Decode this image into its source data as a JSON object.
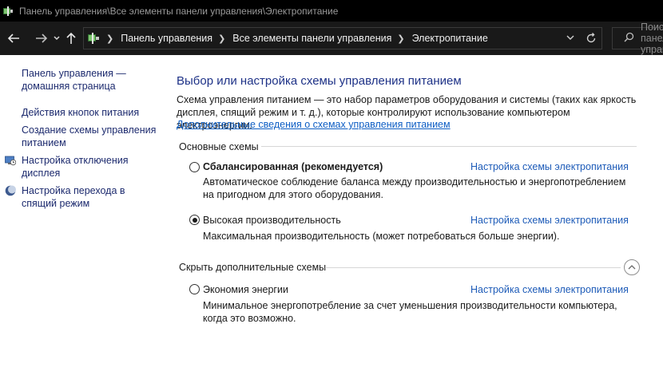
{
  "window": {
    "title": "Панель управления\\Все элементы панели управления\\Электропитание"
  },
  "nav": {
    "back_icon": "arrow-left-icon",
    "forward_icon": "arrow-right-icon",
    "up_icon": "arrow-up-icon",
    "breadcrumbs": [
      "Панель управления",
      "Все элементы панели управления",
      "Электропитание"
    ],
    "search_placeholder": "Поиск в панели управления"
  },
  "sidebar": {
    "items": [
      {
        "label": "Панель управления — домашняя страница"
      },
      {
        "label": "Действия кнопок питания"
      },
      {
        "label": "Создание схемы управления питанием"
      },
      {
        "label": "Настройка отключения дисплея",
        "icon": "display-clock-icon"
      },
      {
        "label": "Настройка перехода в спящий режим",
        "icon": "moon-sleep-icon"
      }
    ]
  },
  "main": {
    "title": "Выбор или настройка схемы управления питанием",
    "description": "Схема управления питанием — это набор параметров оборудования и системы (таких как яркость дисплея, спящий режим и т. д.), которые контролируют использование компьютером электроэнергии.",
    "more_link": "Дополнительные сведения о схемах управления питанием",
    "groups": {
      "basic": "Основные схемы",
      "hidden": "Скрыть дополнительные схемы"
    },
    "schemes": [
      {
        "name": "Сбалансированная (рекомендуется)",
        "selected": false,
        "description": "Автоматическое соблюдение баланса между производительностью и энергопотреблением на пригодном для этого оборудования.",
        "link": "Настройка схемы электропитания"
      },
      {
        "name": "Высокая производительность",
        "selected": true,
        "description": "Максимальная производительность (может потребоваться больше энергии).",
        "link": "Настройка схемы электропитания"
      },
      {
        "name": "Экономия энергии",
        "selected": false,
        "description": "Минимальное энергопотребление за счет уменьшения производительности компьютера, когда это возможно.",
        "link": "Настройка схемы электропитания"
      }
    ]
  }
}
